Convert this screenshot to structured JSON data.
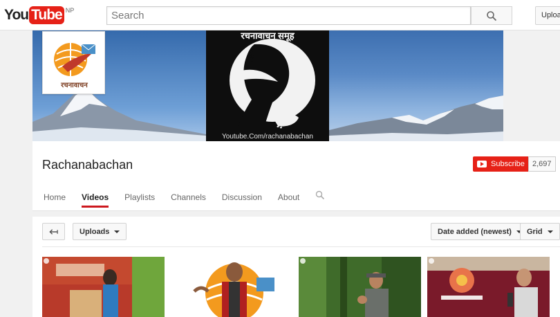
{
  "masthead": {
    "logo_you": "You",
    "logo_tube": "Tube",
    "logo_region": "NP",
    "search_placeholder": "Search",
    "upload_label": "Upload"
  },
  "banner": {
    "center_title": "रचनावाचन समूह",
    "center_url": "Youtube.Com/rachanabachan",
    "avatar_label": "रचनावाचन"
  },
  "channel": {
    "title": "Rachanabachan",
    "subscribe_label": "Subscribe",
    "subscriber_count": "2,697",
    "tabs": [
      {
        "label": "Home",
        "active": false
      },
      {
        "label": "Videos",
        "active": true
      },
      {
        "label": "Playlists",
        "active": false
      },
      {
        "label": "Channels",
        "active": false
      },
      {
        "label": "Discussion",
        "active": false
      },
      {
        "label": "About",
        "active": false
      }
    ]
  },
  "videos_toolbar": {
    "uploads_label": "Uploads",
    "sort_label": "Date added (newest)",
    "view_label": "Grid"
  },
  "colors": {
    "brand_red": "#e62117",
    "tab_underline": "#cc181e"
  }
}
